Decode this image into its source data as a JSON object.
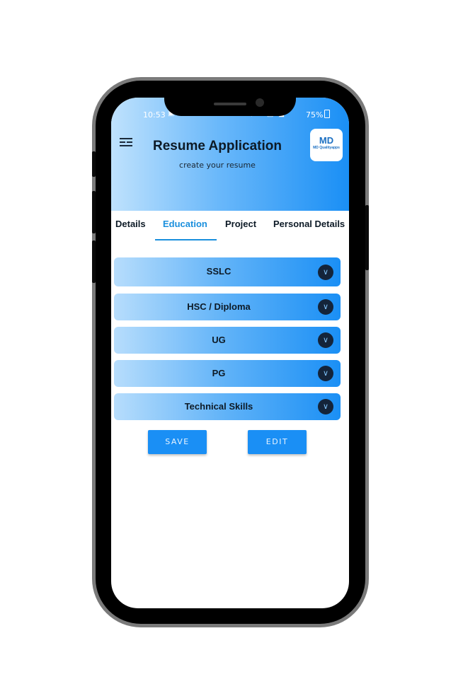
{
  "status_bar": {
    "time": "10:53",
    "icons": "⬧ ▾ ▤ ◢",
    "battery": "75%"
  },
  "app_bar": {
    "menu_icon": "menu-icon",
    "title": "Resume Application",
    "subtitle": "create your resume",
    "logo": {
      "mark": "MD",
      "text": "MD Qualityapps"
    }
  },
  "tabs": [
    "Details",
    "Education",
    "Project",
    "Personal Details"
  ],
  "active_tab": "Education",
  "accordions": [
    {
      "label": "SSLC"
    },
    {
      "label": "HSC / Diploma"
    },
    {
      "label": "UG"
    },
    {
      "label": "PG"
    },
    {
      "label": "Technical Skills"
    }
  ],
  "buttons": {
    "save": "SAVE",
    "edit": "EDIT"
  },
  "colors": {
    "accent": "#1a8ff5",
    "tab_active": "#1a8fdd",
    "chevron_bg": "#14243a"
  }
}
